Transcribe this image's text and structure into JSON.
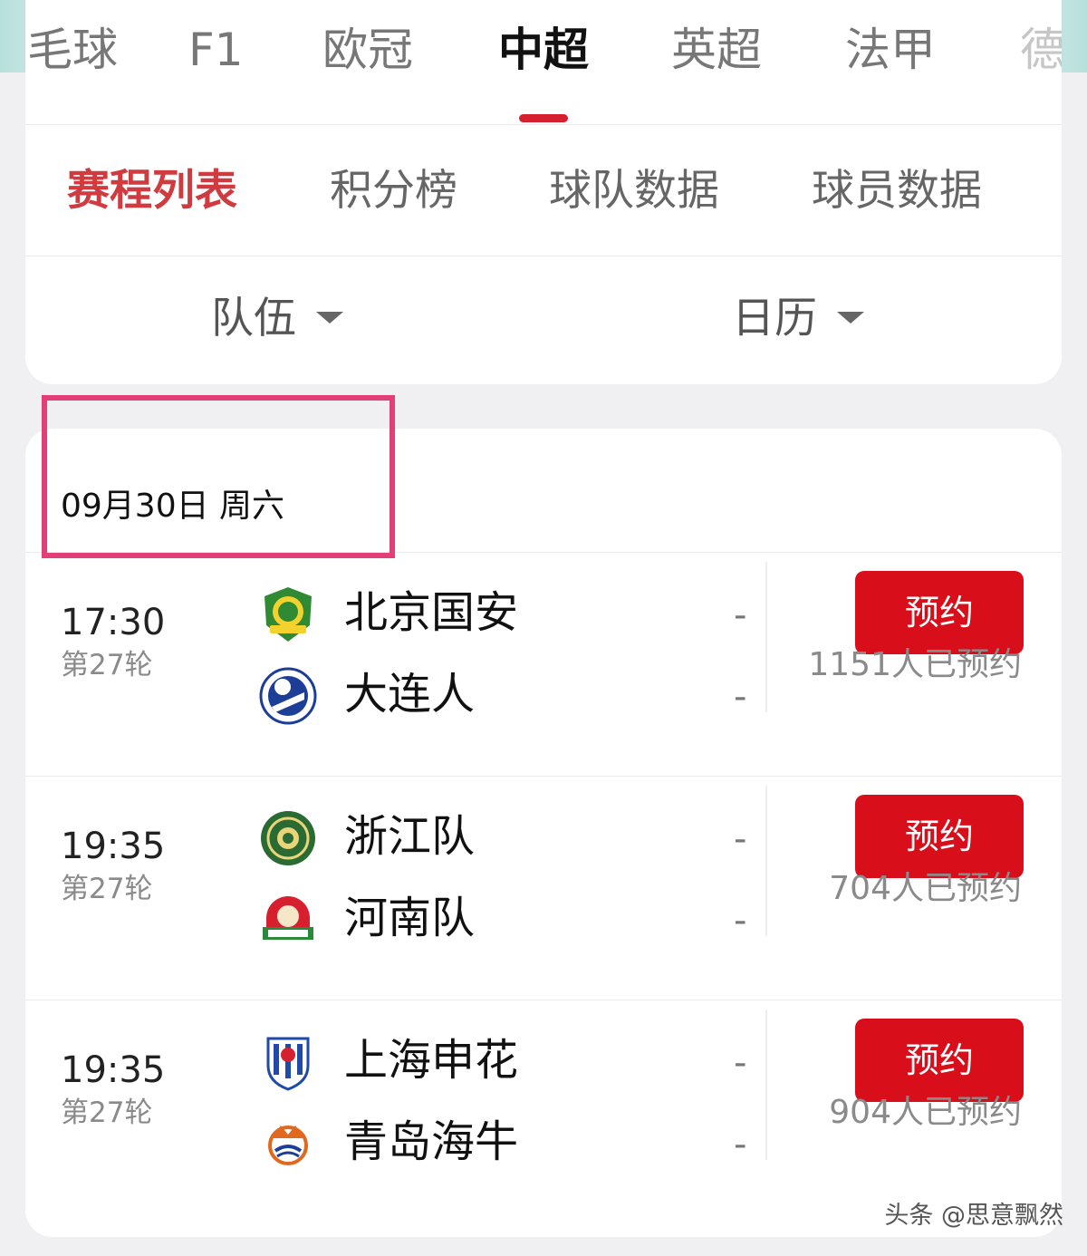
{
  "sports_tabs": [
    "毛球",
    "F1",
    "欧冠",
    "中超",
    "英超",
    "法甲",
    "德"
  ],
  "active_sport": "中超",
  "sub_tabs": [
    "赛程列表",
    "积分榜",
    "球队数据",
    "球员数据"
  ],
  "active_sub_tab": "赛程列表",
  "filters": {
    "team": "队伍",
    "calendar": "日历"
  },
  "date_header": "09月30日 周六",
  "matches": [
    {
      "time": "17:30",
      "round": "第27轮",
      "home": "北京国安",
      "away": "大连人",
      "home_score": "-",
      "away_score": "-",
      "button": "预约",
      "reserve_count": "1151人已预约",
      "home_logo": "guoan-logo-icon",
      "away_logo": "dalian-pro-logo-icon"
    },
    {
      "time": "19:35",
      "round": "第27轮",
      "home": "浙江队",
      "away": "河南队",
      "home_score": "-",
      "away_score": "-",
      "button": "预约",
      "reserve_count": "704人已预约",
      "home_logo": "zhejiang-logo-icon",
      "away_logo": "henan-logo-icon"
    },
    {
      "time": "19:35",
      "round": "第27轮",
      "home": "上海申花",
      "away": "青岛海牛",
      "home_score": "-",
      "away_score": "-",
      "button": "预约",
      "reserve_count": "904人已预约",
      "home_logo": "shenhua-logo-icon",
      "away_logo": "hainiu-logo-icon"
    }
  ],
  "watermark": "头条 @思意飘然",
  "colors": {
    "accent_red": "#d80f1a",
    "active_subtab": "#cf3b3f",
    "highlight_box": "#e23f79"
  }
}
